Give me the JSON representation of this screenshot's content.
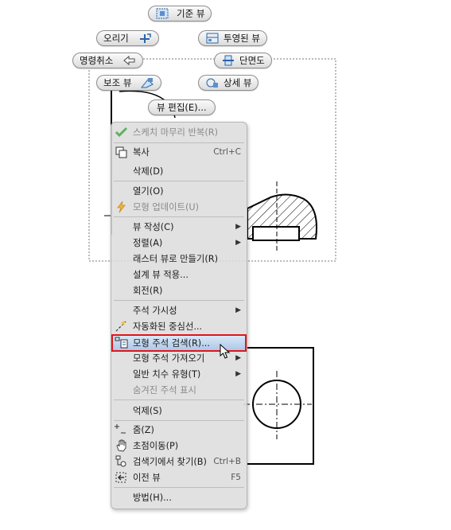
{
  "buttons": {
    "base_view": "기준 뷰",
    "extrude": "오리기",
    "projected_view": "투영된 뷰",
    "undo": "명령취소",
    "section": "단면도",
    "auxiliary_view": "보조 뷰",
    "detail_view": "상세 뷰",
    "edit_view": "뷰 편집(E)..."
  },
  "menu": {
    "items": [
      {
        "label": "스케치 마무리 반복(R)",
        "shortcut": "",
        "disabled": true,
        "icon": "checkmark-icon"
      },
      {
        "label": "복사",
        "shortcut": "Ctrl+C",
        "icon": "copy-icon"
      },
      {
        "label": "삭제(D)"
      },
      {
        "label": "열기(O)"
      },
      {
        "label": "모형 업데이트(U)",
        "disabled": true,
        "icon": "lightning-icon"
      },
      {
        "label": "뷰 작성(C)",
        "submenu": true
      },
      {
        "label": "정렬(A)",
        "submenu": true
      },
      {
        "label": "래스터 뷰로 만들기(R)"
      },
      {
        "label": "설계 뷰 적용..."
      },
      {
        "label": "회전(R)"
      },
      {
        "label": "주석 가시성",
        "submenu": true
      },
      {
        "label": "자동화된 중심선...",
        "icon": "centerline-icon"
      },
      {
        "label": "모형 주석 검색(R)...",
        "icon": "annotation-search-icon",
        "highlighted": true
      },
      {
        "label": "모형 주석 가져오기",
        "submenu": true
      },
      {
        "label": "일반 치수 유형(T)",
        "submenu": true
      },
      {
        "label": "숨겨진 주석 표시",
        "disabled": true
      },
      {
        "label": "억제(S)"
      },
      {
        "label": "줌(Z)",
        "icon": "zoom-icon"
      },
      {
        "label": "초점이동(P)",
        "icon": "pan-hand-icon"
      },
      {
        "label": "검색기에서 찾기(B)",
        "shortcut": "Ctrl+B",
        "icon": "find-in-browser-icon"
      },
      {
        "label": "이전 뷰",
        "shortcut": "F5",
        "icon": "previous-view-icon"
      },
      {
        "label": "방법(H)..."
      }
    ],
    "submenu_arrow": "▶"
  }
}
